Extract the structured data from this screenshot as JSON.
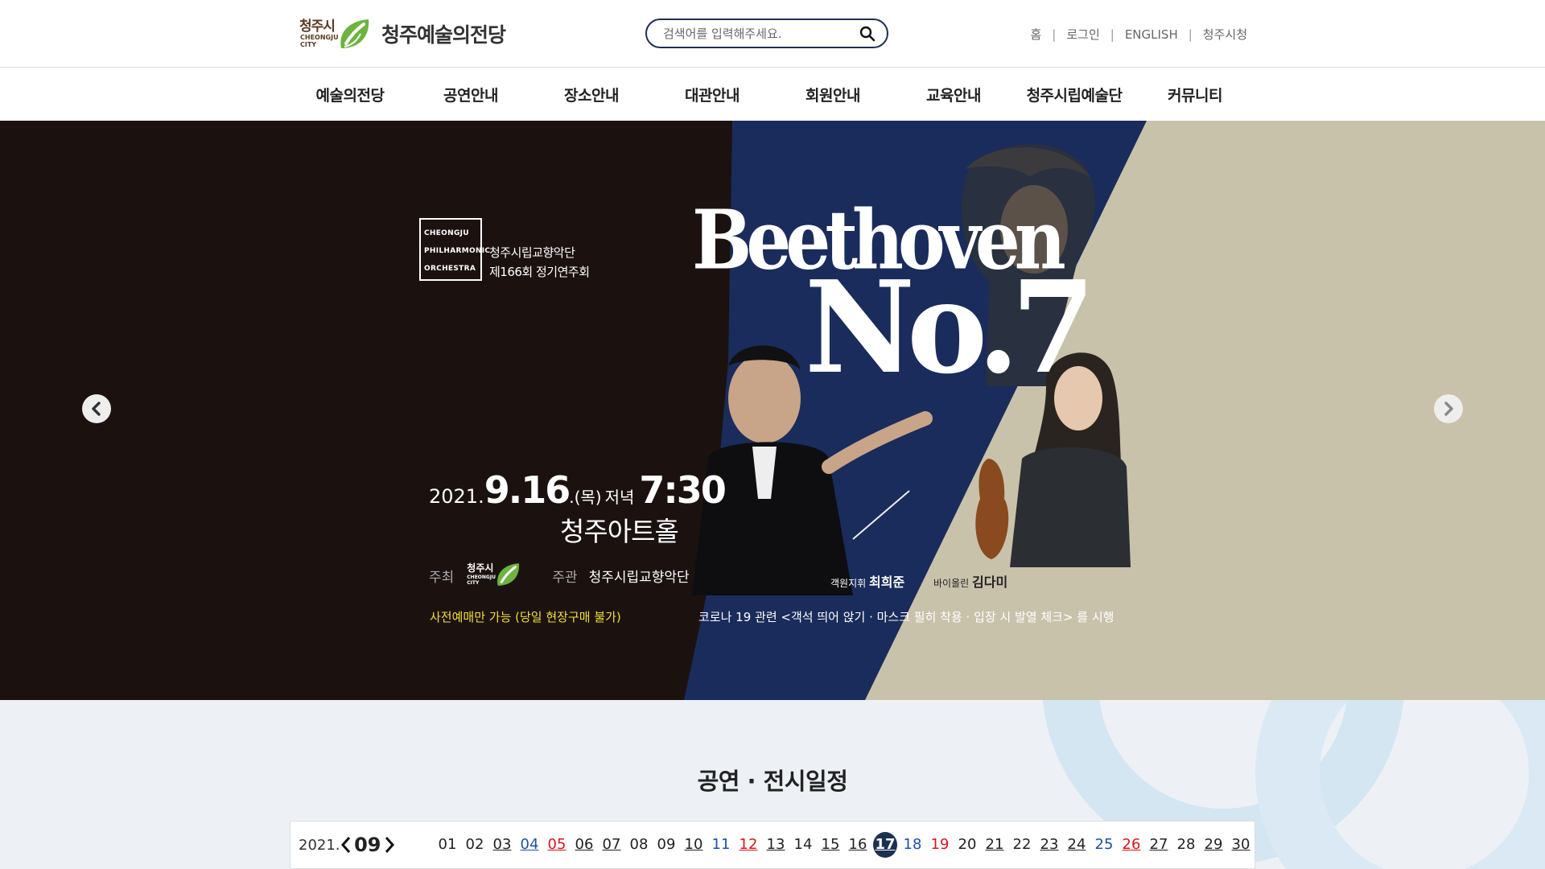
{
  "header": {
    "logo_city_ko": "청주시",
    "logo_city_en_1": "CHEONGJU",
    "logo_city_en_2": "CITY",
    "logo_title": "청주예술의전당",
    "search_placeholder": "검색어를 입력해주세요.",
    "util_links": [
      "홈",
      "로그인",
      "ENGLISH",
      "청주시청"
    ]
  },
  "gnb": {
    "items": [
      "예술의전당",
      "공연안내",
      "장소안내",
      "대관안내",
      "회원안내",
      "교육안내",
      "청주시립예술단",
      "커뮤니티"
    ]
  },
  "hero": {
    "orchestra_logo": [
      "CHEONGJU",
      "PHILHARMONIC",
      "ORCHESTRA"
    ],
    "org_line1": "청주시립교향악단",
    "org_line2": "제166회 정기연주회",
    "composer": "Beethoven",
    "work": "No.7",
    "date_year": "2021.",
    "date_md": "9.16",
    "date_dow": ".(목)",
    "date_evening": "저녁",
    "date_time": "7:30",
    "venue": "청주아트홀",
    "host_label": "주최",
    "host_city_ko": "청주시",
    "host_city_en_1": "CHEONGJU",
    "host_city_en_2": "CITY",
    "organizer_label": "주관",
    "organizer_name": "청주시립교향악단",
    "conductor_role": "객원지휘",
    "conductor_name": "최희준",
    "violin_role": "바이올린",
    "violin_name": "김다미",
    "notice_advance": "사전예매만 가능 (당일 현장구매 불가)",
    "notice_covid": "코로나 19 관련 <객석 띄어 앉기 · 마스크 필히 착용 · 입장 시 발열 체크> 를 시행"
  },
  "schedule": {
    "title": "공연 · 전시일정",
    "year": "2021.",
    "month": "09",
    "today": "17",
    "days": [
      {
        "d": "01",
        "type": "",
        "event": false
      },
      {
        "d": "02",
        "type": "",
        "event": false
      },
      {
        "d": "03",
        "type": "",
        "event": true
      },
      {
        "d": "04",
        "type": "sat",
        "event": true
      },
      {
        "d": "05",
        "type": "sun",
        "event": true
      },
      {
        "d": "06",
        "type": "",
        "event": true
      },
      {
        "d": "07",
        "type": "",
        "event": true
      },
      {
        "d": "08",
        "type": "",
        "event": false
      },
      {
        "d": "09",
        "type": "",
        "event": false
      },
      {
        "d": "10",
        "type": "",
        "event": true
      },
      {
        "d": "11",
        "type": "sat",
        "event": false
      },
      {
        "d": "12",
        "type": "sun",
        "event": true
      },
      {
        "d": "13",
        "type": "",
        "event": true
      },
      {
        "d": "14",
        "type": "",
        "event": false
      },
      {
        "d": "15",
        "type": "",
        "event": true
      },
      {
        "d": "16",
        "type": "",
        "event": true
      },
      {
        "d": "17",
        "type": "",
        "event": true
      },
      {
        "d": "18",
        "type": "sat",
        "event": false
      },
      {
        "d": "19",
        "type": "sun",
        "event": false
      },
      {
        "d": "20",
        "type": "",
        "event": false
      },
      {
        "d": "21",
        "type": "",
        "event": true
      },
      {
        "d": "22",
        "type": "",
        "event": false
      },
      {
        "d": "23",
        "type": "",
        "event": true
      },
      {
        "d": "24",
        "type": "",
        "event": true
      },
      {
        "d": "25",
        "type": "sat",
        "event": false
      },
      {
        "d": "26",
        "type": "sun",
        "event": true
      },
      {
        "d": "27",
        "type": "",
        "event": true
      },
      {
        "d": "28",
        "type": "",
        "event": false
      },
      {
        "d": "29",
        "type": "",
        "event": true
      },
      {
        "d": "30",
        "type": "",
        "event": true
      }
    ]
  },
  "colors": {
    "navy": "#1d3050",
    "leaf_green": "#6cb33f",
    "hero_dark": "#1b1210",
    "hero_blue": "#1a2c5b",
    "hero_beige": "#c8c2ab",
    "notice_yellow": "#f2df3a",
    "saturday": "#1e4fa8",
    "sunday": "#d3161c"
  },
  "icons": [
    "search-icon",
    "leaf-logo-icon",
    "chevron-left-icon",
    "chevron-right-icon"
  ]
}
